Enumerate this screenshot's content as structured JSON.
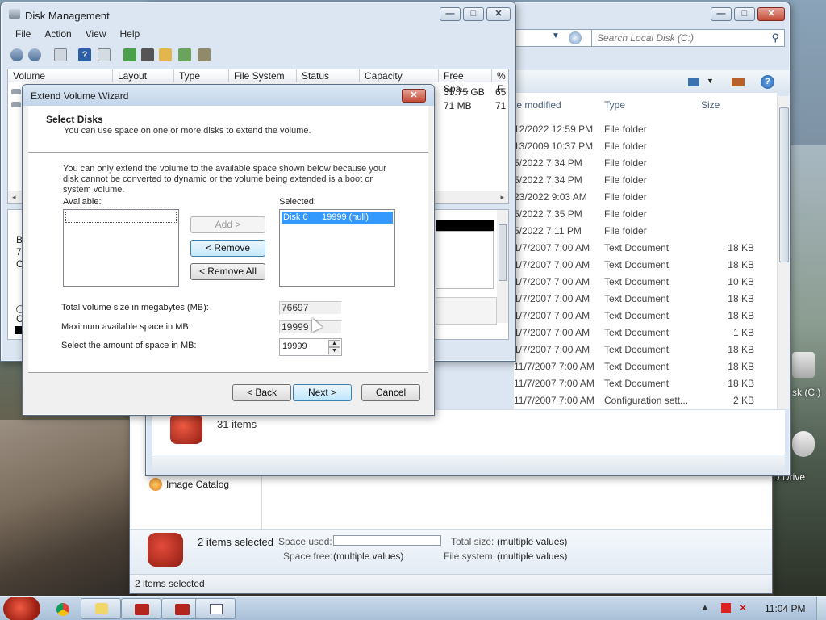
{
  "disk_mgmt": {
    "title": "Disk Management",
    "menu": [
      "File",
      "Action",
      "View",
      "Help"
    ],
    "columns": [
      "Volume",
      "Layout",
      "Type",
      "File System",
      "Status",
      "Capacity",
      "Free Spa...",
      "% F"
    ],
    "rows": [
      {
        "free": "35.75 GB",
        "pct": "65"
      },
      {
        "free": "71 MB",
        "pct": "71"
      }
    ],
    "left_letters": [
      "B",
      "7",
      "C"
    ],
    "left_letters2": [
      "C"
    ]
  },
  "explorer": {
    "search_placeholder": "Search Local Disk (C:)",
    "col_date": "te modified",
    "col_type": "Type",
    "col_size": "Size",
    "files": [
      {
        "date": "12/2022 12:59 PM",
        "type": "File folder",
        "size": ""
      },
      {
        "date": "13/2009 10:37 PM",
        "type": "File folder",
        "size": ""
      },
      {
        "date": "5/2022 7:34 PM",
        "type": "File folder",
        "size": ""
      },
      {
        "date": "5/2022 7:34 PM",
        "type": "File folder",
        "size": ""
      },
      {
        "date": "23/2022 9:03 AM",
        "type": "File folder",
        "size": ""
      },
      {
        "date": "5/2022 7:35 PM",
        "type": "File folder",
        "size": ""
      },
      {
        "date": "5/2022 7:11 PM",
        "type": "File folder",
        "size": ""
      },
      {
        "date": "1/7/2007 7:00 AM",
        "type": "Text Document",
        "size": "18 KB"
      },
      {
        "date": "1/7/2007 7:00 AM",
        "type": "Text Document",
        "size": "18 KB"
      },
      {
        "date": "1/7/2007 7:00 AM",
        "type": "Text Document",
        "size": "10 KB"
      },
      {
        "date": "1/7/2007 7:00 AM",
        "type": "Text Document",
        "size": "18 KB"
      },
      {
        "date": "1/7/2007 7:00 AM",
        "type": "Text Document",
        "size": "18 KB"
      },
      {
        "date": "1/7/2007 7:00 AM",
        "type": "Text Document",
        "size": "1 KB"
      },
      {
        "date": "1/7/2007 7:00 AM",
        "type": "Text Document",
        "size": "18 KB"
      },
      {
        "date": "11/7/2007 7:00 AM",
        "type": "Text Document",
        "size": "18 KB"
      },
      {
        "date": "11/7/2007 7:00 AM",
        "type": "Text Document",
        "size": "18 KB"
      },
      {
        "date": "11/7/2007 7:00 AM",
        "type": "Configuration sett...",
        "size": "2 KB"
      }
    ],
    "items_count": "31 items"
  },
  "computer": {
    "image_catalog": "Image Catalog",
    "selection_label": "2 items selected",
    "space_used_label": "Space used:",
    "total_size_label": "Total size:",
    "total_size_value": "(multiple values)",
    "space_free_label": "Space free:",
    "space_free_value": "(multiple values)",
    "file_system_label": "File system:",
    "file_system_value": "(multiple values)",
    "status_bar": "2 items selected",
    "desktop_label_1": "sk (C:)",
    "desktop_label_2": "D Drive"
  },
  "wizard": {
    "title": "Extend Volume Wizard",
    "heading": "Select Disks",
    "subheading": "You can use space on one or more disks to extend the volume.",
    "info": "You can only extend the volume to the available space shown below because your disk cannot be converted to dynamic or the volume being extended is a boot or system volume.",
    "available_label": "Available:",
    "selected_label": "Selected:",
    "selected_item_disk": "Disk 0",
    "selected_item_size": "19999 (null)",
    "add_button": "Add >",
    "remove_button": "< Remove",
    "remove_all_button": "< Remove All",
    "total_label": "Total volume size in megabytes (MB):",
    "total_value": "76697",
    "max_label": "Maximum available space in MB:",
    "max_value": "19999",
    "amount_label": "Select the amount of space in MB:",
    "amount_value": "19999",
    "back_button": "< Back",
    "next_button": "Next >",
    "cancel_button": "Cancel"
  },
  "taskbar": {
    "clock": "11:04 PM"
  }
}
